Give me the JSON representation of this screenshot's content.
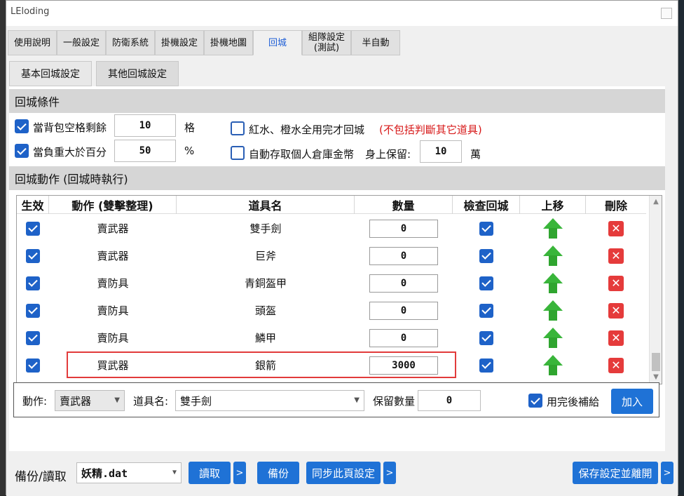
{
  "window": {
    "title": "LEloding"
  },
  "tabs": [
    {
      "label": "使用說明"
    },
    {
      "label": "一般設定"
    },
    {
      "label": "防衛系統"
    },
    {
      "label": "掛機設定"
    },
    {
      "label": "掛機地圖"
    },
    {
      "label": "回城"
    },
    {
      "label": "組隊設定\n(測試)"
    },
    {
      "label": "半自動"
    }
  ],
  "subtabs": [
    {
      "label": "基本回城設定"
    },
    {
      "label": "其他回城設定"
    }
  ],
  "conditions": {
    "header": "回城條件",
    "bag_label": "當背包空格剩餘",
    "bag_value": "10",
    "bag_unit": "格",
    "weight_label": "當負重大於百分",
    "weight_value": "50",
    "weight_unit": "%",
    "potion_label": "紅水、橙水全用完才回城",
    "potion_note": "(不包括判斷其它道具)",
    "deposit_label": "自動存取個人倉庫金幣",
    "keep_label": "身上保留:",
    "keep_value": "10",
    "keep_unit": "萬"
  },
  "actions": {
    "header": "回城動作 (回城時執行)",
    "columns": [
      "生效",
      "動作 (雙擊整理)",
      "道具名",
      "數量",
      "檢查回城",
      "上移",
      "刪除"
    ],
    "rows": [
      {
        "enabled": true,
        "action": "賣武器",
        "item": "雙手劍",
        "qty": "0",
        "check": true
      },
      {
        "enabled": true,
        "action": "賣武器",
        "item": "巨斧",
        "qty": "0",
        "check": true
      },
      {
        "enabled": true,
        "action": "賣防具",
        "item": "青銅盔甲",
        "qty": "0",
        "check": true
      },
      {
        "enabled": true,
        "action": "賣防具",
        "item": "頭盔",
        "qty": "0",
        "check": true
      },
      {
        "enabled": true,
        "action": "賣防具",
        "item": "鱗甲",
        "qty": "0",
        "check": true
      },
      {
        "enabled": true,
        "action": "買武器",
        "item": "銀箭",
        "qty": "3000",
        "check": true
      }
    ]
  },
  "add_bar": {
    "action_label": "動作:",
    "action_value": "賣武器",
    "item_label": "道具名:",
    "item_value": "雙手劍",
    "keep_label": "保留數量",
    "keep_value": "0",
    "refill_label": "用完後補給",
    "add_button": "加入"
  },
  "footer": {
    "backup_label": "備份/讀取",
    "file_value": "妖精.dat",
    "read_button": "讀取",
    "backup_button": "備份",
    "sync_button": "同步此頁設定",
    "save_button": "保存設定並離開",
    "arrow": ">"
  }
}
